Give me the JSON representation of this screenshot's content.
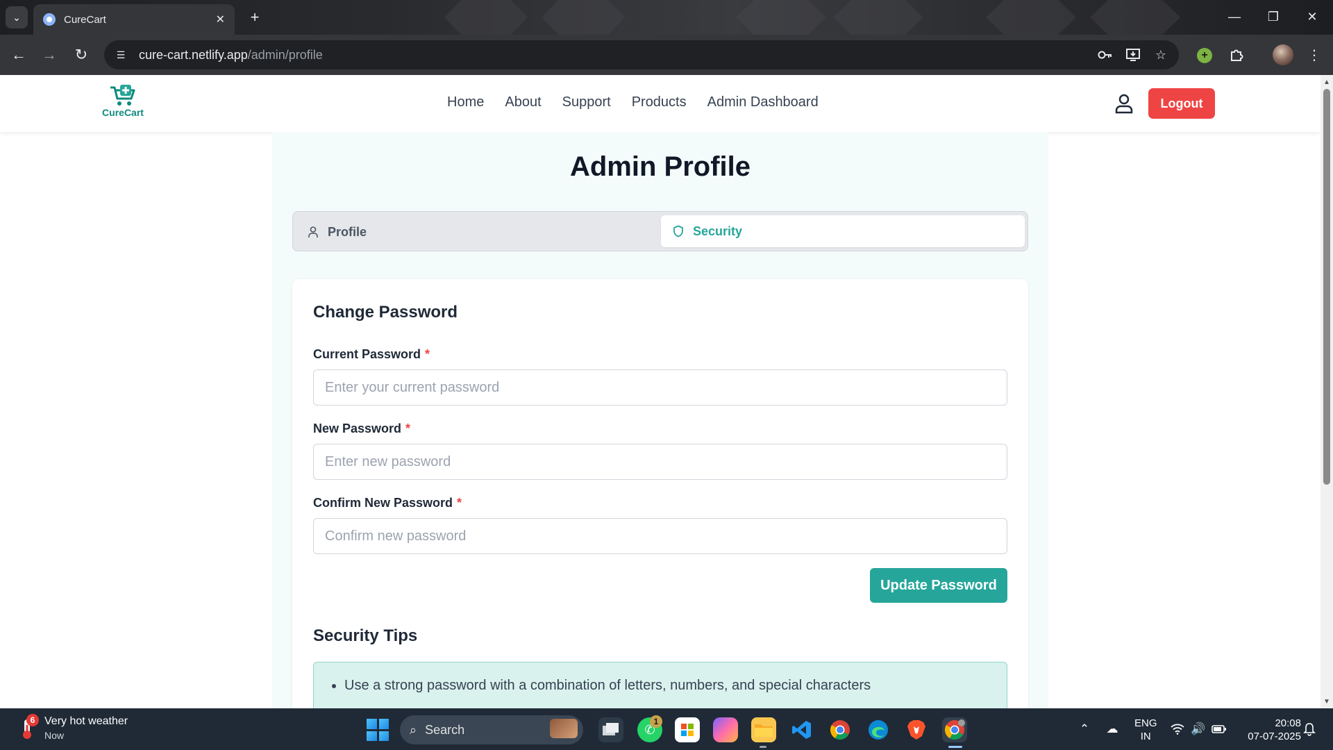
{
  "browser": {
    "tab_title": "CureCart",
    "tab_close": "✕",
    "new_tab": "+",
    "url_host": "cure-cart.netlify.app",
    "url_path": "/admin/profile",
    "window_controls": {
      "minimize": "—",
      "restore": "❐",
      "close": "✕"
    },
    "nav": {
      "back": "←",
      "forward": "→",
      "reload": "↻"
    }
  },
  "site": {
    "logo_text": "CureCart",
    "nav_items": [
      "Home",
      "About",
      "Support",
      "Products",
      "Admin Dashboard"
    ],
    "logout_label": "Logout",
    "brand_color": "#26a69a",
    "logout_color": "#ef4444"
  },
  "page": {
    "title": "Admin Profile",
    "tabs": [
      {
        "label": "Profile",
        "icon": "user-icon",
        "active": false
      },
      {
        "label": "Security",
        "icon": "shield-icon",
        "active": true
      }
    ]
  },
  "change_password": {
    "heading": "Change Password",
    "required_mark": "*",
    "fields": [
      {
        "label": "Current Password",
        "placeholder": "Enter your current password",
        "value": ""
      },
      {
        "label": "New Password",
        "placeholder": "Enter new password",
        "value": ""
      },
      {
        "label": "Confirm New Password",
        "placeholder": "Confirm new password",
        "value": ""
      }
    ],
    "submit_label": "Update Password"
  },
  "security_tips": {
    "heading": "Security Tips",
    "items": [
      "Use a strong password with a combination of letters, numbers, and special characters"
    ]
  },
  "taskbar": {
    "weather_badge": "6",
    "weather_title": "Very hot weather",
    "weather_sub": "Now",
    "search_label": "Search",
    "whatsapp_badge": "1",
    "lang_line1": "ENG",
    "lang_line2": "IN",
    "time": "20:08",
    "date": "07-07-2025"
  }
}
